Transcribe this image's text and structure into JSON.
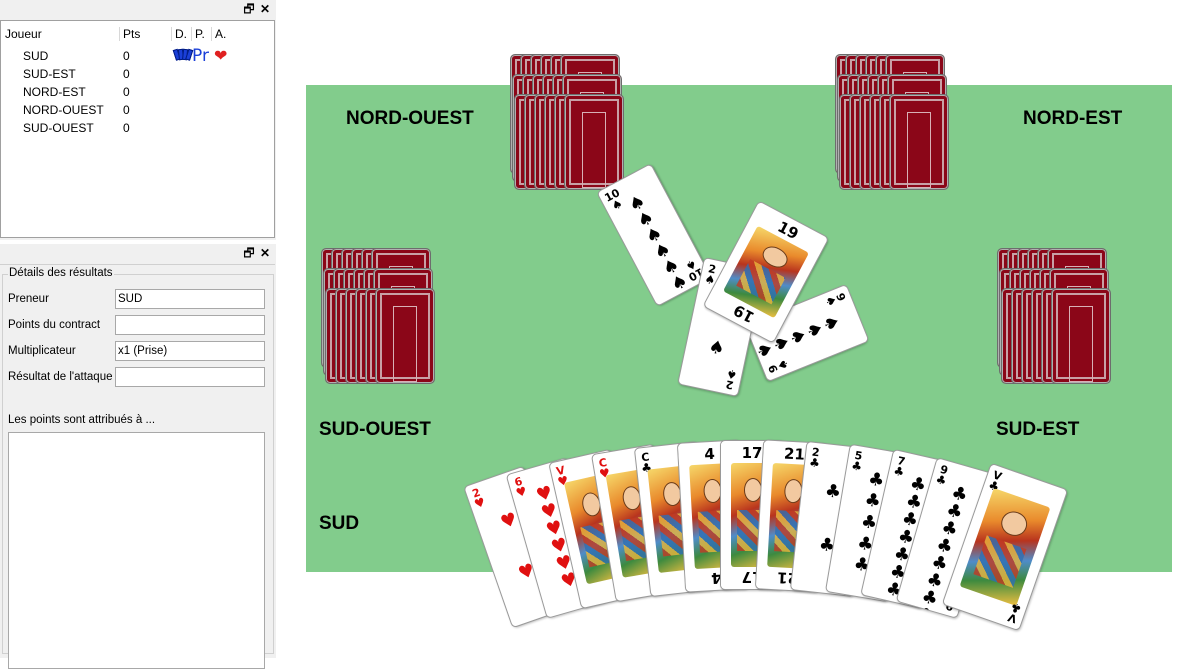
{
  "players_panel": {
    "headers": {
      "player": "Joueur",
      "points": "Pts",
      "dealer": "D.",
      "taker": "P.",
      "called": "A."
    },
    "rows": [
      {
        "name": "SUD",
        "points": "0",
        "taker_mark": "Pr",
        "called_icon": "heart-icon",
        "dealer_icon": "cards-icon"
      },
      {
        "name": "SUD-EST",
        "points": "0"
      },
      {
        "name": "NORD-EST",
        "points": "0"
      },
      {
        "name": "NORD-OUEST",
        "points": "0"
      },
      {
        "name": "SUD-OUEST",
        "points": "0"
      }
    ],
    "heart_glyph": "❤"
  },
  "details_panel": {
    "group_title": "Détails des résultats",
    "fields": [
      {
        "label": "Preneur",
        "value": "SUD"
      },
      {
        "label": "Points du contract",
        "value": ""
      },
      {
        "label": "Multiplicateur",
        "value": "x1 (Prise)"
      },
      {
        "label": "Résultat de l'attaque",
        "value": ""
      }
    ],
    "points_label": "Les points sont attribués à ..."
  },
  "dock_buttons": {
    "float": "🗗",
    "close": "✕"
  },
  "table": {
    "felt_color": "#82cc8c",
    "card_back_color": "#8b0618",
    "players": {
      "north_west": "NORD-OUEST",
      "north_east": "NORD-EST",
      "south_west": "SUD-OUEST",
      "south_east": "SUD-EST",
      "south": "SUD"
    },
    "trick": [
      {
        "rank": "10",
        "suit": "♠",
        "color": "black"
      },
      {
        "rank": "19",
        "suit": "trump",
        "color": "black"
      },
      {
        "rank": "9",
        "suit": "♠",
        "color": "black"
      },
      {
        "rank": "2",
        "suit": "♠",
        "color": "black"
      }
    ],
    "hand": [
      {
        "rank": "2",
        "suit": "♥",
        "color": "red",
        "type": "pip",
        "pips": 2
      },
      {
        "rank": "6",
        "suit": "♥",
        "color": "red",
        "type": "pip",
        "pips": 6
      },
      {
        "rank": "V",
        "suit": "♥",
        "color": "red",
        "type": "face"
      },
      {
        "rank": "C",
        "suit": "♥",
        "color": "red",
        "type": "face"
      },
      {
        "rank": "C",
        "suit": "♣",
        "color": "black",
        "type": "face"
      },
      {
        "rank": "4",
        "suit": "trump",
        "color": "black",
        "type": "trump"
      },
      {
        "rank": "17",
        "suit": "trump",
        "color": "black",
        "type": "trump"
      },
      {
        "rank": "21",
        "suit": "trump",
        "color": "black",
        "type": "trump"
      },
      {
        "rank": "2",
        "suit": "♣",
        "color": "black",
        "type": "pip",
        "pips": 2
      },
      {
        "rank": "5",
        "suit": "♣",
        "color": "black",
        "type": "pip",
        "pips": 5
      },
      {
        "rank": "7",
        "suit": "♣",
        "color": "black",
        "type": "pip",
        "pips": 7
      },
      {
        "rank": "9",
        "suit": "♣",
        "color": "black",
        "type": "pip",
        "pips": 9
      },
      {
        "rank": "V",
        "suit": "♣",
        "color": "black",
        "type": "face"
      }
    ]
  }
}
